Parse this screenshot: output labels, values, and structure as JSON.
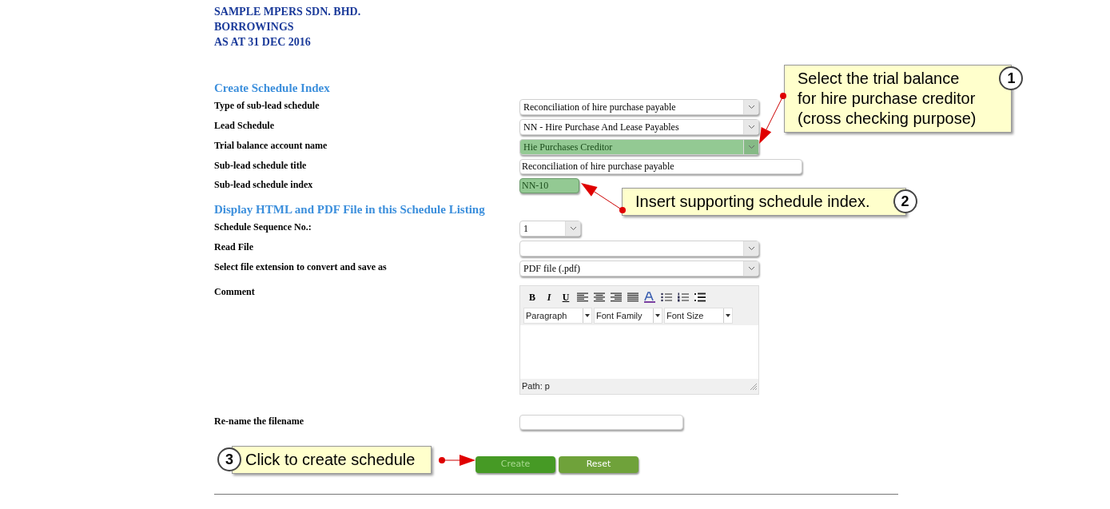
{
  "header": {
    "lines": [
      "SAMPLE MPERS SDN. BHD.",
      "BORROWINGS",
      "AS AT 31 DEC 2016"
    ]
  },
  "sections": [
    {
      "title": "Create Schedule Index",
      "fields": [
        {
          "label": "Type of sub-lead schedule",
          "kind": "select",
          "value": "Reconciliation of hire purchase payable",
          "highlighted": false
        },
        {
          "label": "Lead Schedule",
          "kind": "select",
          "value": "NN - Hire Purchase And Lease Payables",
          "highlighted": false
        },
        {
          "label": "Trial balance account name",
          "kind": "select",
          "value": "Hie Purchases Creditor",
          "highlighted": true
        },
        {
          "label": "Sub-lead schedule title",
          "kind": "input",
          "value": "Reconciliation of hire purchase payable",
          "highlighted": false
        },
        {
          "label": "Sub-lead schedule index",
          "kind": "short-input",
          "value": "NN-10",
          "highlighted": true
        }
      ]
    },
    {
      "title": "Display HTML and PDF File in this Schedule Listing",
      "fields": [
        {
          "label": "Schedule Sequence No.:",
          "kind": "short-select",
          "value": "1",
          "highlighted": false
        },
        {
          "label": "Read File",
          "kind": "select",
          "highlighted": false
        },
        {
          "label": "Select file extension to convert and save as",
          "kind": "select",
          "value": "PDF file (.pdf)",
          "highlighted": false
        },
        {
          "label": "Comment",
          "kind": "editor",
          "format_buttons": [
            "B",
            "I",
            "U"
          ],
          "dropdowns": [
            "Paragraph",
            "Font Family",
            "Font Size"
          ],
          "status": "Path: p"
        },
        {
          "label": "Re-name the filename",
          "kind": "rename-input",
          "highlighted": false
        }
      ]
    }
  ],
  "buttons": [
    {
      "label": "Create",
      "kind": "primary"
    },
    {
      "label": "Reset",
      "kind": "secondary"
    }
  ],
  "callouts": [
    {
      "number": "1",
      "lines": [
        "Select the trial balance",
        "for hire purchase creditor",
        "(cross checking purpose)"
      ]
    },
    {
      "number": "2",
      "lines": [
        "Insert supporting schedule index."
      ]
    },
    {
      "number": "3",
      "lines": [
        "Click to create schedule"
      ]
    }
  ]
}
